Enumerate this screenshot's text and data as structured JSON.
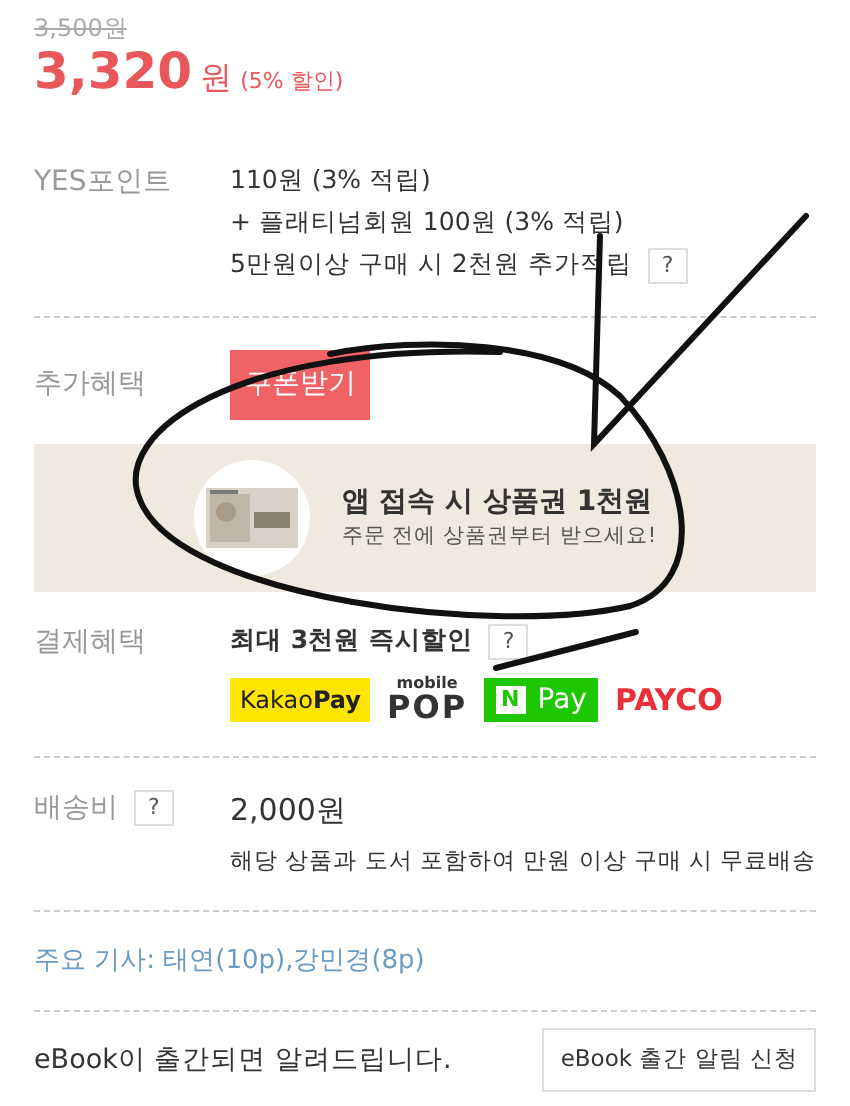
{
  "price": {
    "original": "3,500원",
    "sale": "3,320",
    "unit": "원",
    "discount": "(5% 할인)"
  },
  "points": {
    "label": "YES포인트",
    "lines": [
      "110원 (3% 적립)",
      "+ 플래티넘회원 100원 (3% 적립)",
      "5만원이상 구매 시 2천원 추가적립"
    ],
    "help": "?"
  },
  "extra": {
    "label": "추가혜택",
    "button": "쿠폰받기"
  },
  "banner": {
    "title": "앱 접속 시 상품권 1천원",
    "subtitle": "주문 전에 상품권부터 받으세요!"
  },
  "payment": {
    "label": "결제혜택",
    "text": "최대 3천원 즉시할인",
    "help": "?",
    "methods": [
      {
        "kind": "kakaopay",
        "parts": [
          "Kakao",
          "Pay"
        ]
      },
      {
        "kind": "mobilepop",
        "parts": [
          "mobile",
          "POP"
        ]
      },
      {
        "kind": "npay",
        "parts": [
          "N",
          "Pay"
        ]
      },
      {
        "kind": "payco",
        "parts": [
          "PAYCO"
        ]
      }
    ]
  },
  "shipping": {
    "label": "배송비",
    "help": "?",
    "fee": "2,000원",
    "note": "해당 상품과 도서 포함하여 만원 이상 구매 시 무료배송"
  },
  "articles": {
    "text": "주요 기사: 태연(10p),강민경(8p)"
  },
  "ebook": {
    "text": "eBook이 출간되면 알려드립니다.",
    "button": "eBook 출간 알림 신청"
  }
}
